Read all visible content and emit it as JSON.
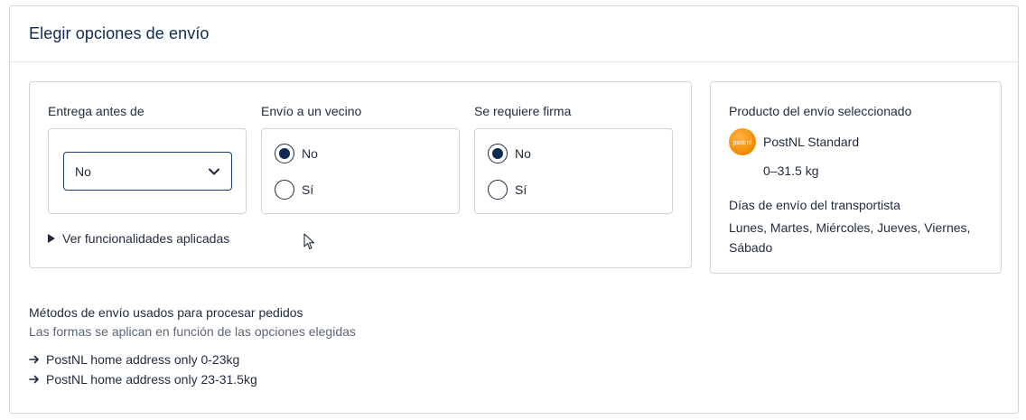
{
  "title": "Elegir opciones de envío",
  "delivery_before": {
    "label": "Entrega antes de",
    "selected": "No"
  },
  "neighbor": {
    "label": "Envío a un vecino",
    "options": [
      {
        "label": "No",
        "checked": true
      },
      {
        "label": "Sí",
        "checked": false
      }
    ]
  },
  "signature": {
    "label": "Se requiere firma",
    "options": [
      {
        "label": "No",
        "checked": true
      },
      {
        "label": "Sí",
        "checked": false
      }
    ]
  },
  "features_toggle": "Ver funcionalidades aplicadas",
  "product": {
    "heading": "Producto del envío seleccionado",
    "carrier_name": "PostNL Standard",
    "weight": "0–31.5 kg",
    "days_heading": "Días de envío del transportista",
    "days": "Lunes, Martes, Miércoles, Jueves, Viernes, Sábado",
    "logo_text": "post nl"
  },
  "methods": {
    "title": "Métodos de envío usados para procesar pedidos",
    "subtitle": "Las formas se aplican en función de las opciones elegidas",
    "items": [
      "PostNL home address only 0-23kg",
      "PostNL home address only 23-31.5kg"
    ]
  },
  "colors": {
    "accent": "#0f2a52",
    "border": "#cdd5e1",
    "carrier_orange": "#f08a00"
  }
}
